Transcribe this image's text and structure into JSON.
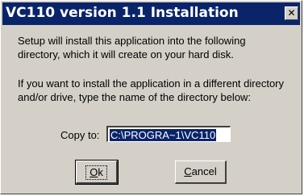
{
  "window": {
    "title": "VC110 version 1.1 Installation",
    "close_glyph": "✕"
  },
  "message": {
    "line1": "Setup will install this application into the following\ndirectory, which it will create on your hard disk.",
    "line2": "If you want to install the application in a different directory\nand/or drive, type the name of the directory below:"
  },
  "copy_to": {
    "label": "Copy to:",
    "value": "C:\\PROGRA~1\\VC110"
  },
  "buttons": {
    "ok": {
      "mnemonic": "O",
      "rest": "k"
    },
    "cancel": {
      "mnemonic": "C",
      "rest": "ancel"
    }
  },
  "colors": {
    "titlebar": "#0a246a",
    "face": "#d4d0c8",
    "selection": "#0a246a"
  }
}
